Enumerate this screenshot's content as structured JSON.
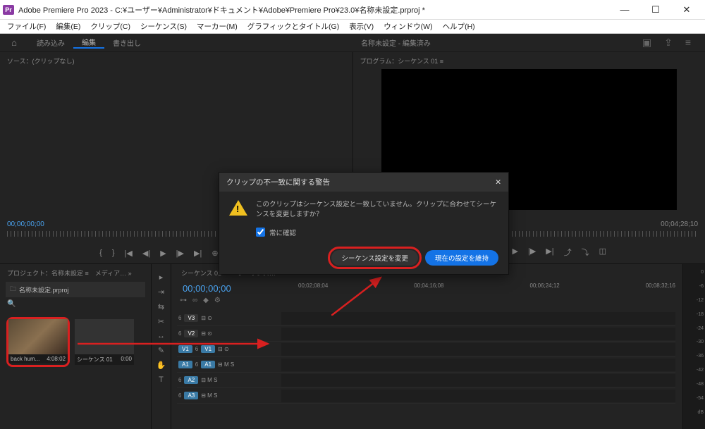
{
  "titlebar": {
    "icon_label": "Pr",
    "title": "Adobe Premiere Pro 2023 - C:¥ユーザー¥Administrator¥ドキュメント¥Adobe¥Premiere Pro¥23.0¥名称未設定.prproj *"
  },
  "menu": {
    "file": "ファイル(F)",
    "edit": "編集(E)",
    "clip": "クリップ(C)",
    "sequence": "シーケンス(S)",
    "marker": "マーカー(M)",
    "graphics": "グラフィックとタイトル(G)",
    "view": "表示(V)",
    "window": "ウィンドウ(W)",
    "help": "ヘルプ(H)"
  },
  "header_tabs": {
    "import": "読み込み",
    "edit": "編集",
    "export": "書き出し",
    "center_label": "名称未設定 - 編集済み"
  },
  "source_panel": {
    "label": "ソース：(クリップなし)",
    "timecode": "00;00;00;00"
  },
  "program_panel": {
    "label": "プログラム：シーケンス 01 ≡",
    "timecode_right": "00;04;28;10"
  },
  "project_panel": {
    "tabs": "プロジェクト：名称未設定 ≡　メディア… »",
    "name": "名称未設定.prproj",
    "items": [
      {
        "name": "back hum...",
        "duration": "4:08:02"
      },
      {
        "name": "シーケンス 01",
        "duration": "0:00"
      }
    ]
  },
  "timeline": {
    "tabs": "シーケンス 01　×　シーケンス… ≡",
    "timecode": "00;00;00;00",
    "ruler_marks": [
      "00;02;08;04",
      "00;04;16;08",
      "00;06;24;12",
      "00;08;32;16"
    ],
    "tracks": {
      "v3": "V3",
      "v2": "V2",
      "v1": "V1",
      "a1": "A1",
      "a2": "A2",
      "a3": "A3"
    }
  },
  "audio_meter": {
    "marks": [
      "0",
      "-6",
      "-12",
      "-18",
      "-24",
      "-30",
      "-36",
      "-42",
      "-48",
      "-54",
      "dB"
    ]
  },
  "dialog": {
    "title": "クリップの不一致に関する警告",
    "message": "このクリップはシーケンス設定と一致していません。クリップに合わせてシーケンスを変更しますか？",
    "checkbox_label": "常に確認",
    "button_primary": "シーケンス設定を変更",
    "button_secondary": "現在の設定を維持"
  },
  "icons": {
    "home": "⌂",
    "share": "⇪",
    "settings": "≡",
    "minimize": "—",
    "maximize": "☐",
    "close": "✕",
    "bin": "🗀",
    "search": "🔍"
  }
}
